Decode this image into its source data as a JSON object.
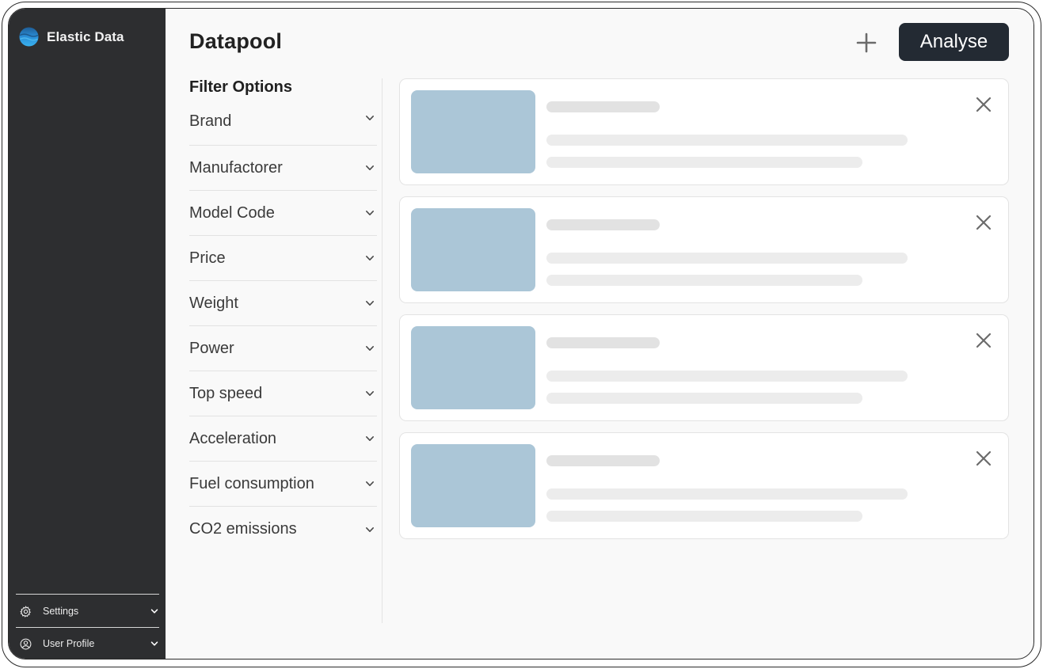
{
  "app": {
    "name": "Elastic Data",
    "logo_icon": "globe-logo-icon"
  },
  "sidebar": {
    "bottom_items": [
      {
        "label": "Settings",
        "icon": "gear-icon"
      },
      {
        "label": "User Profile",
        "icon": "user-circle-icon"
      }
    ]
  },
  "header": {
    "title": "Datapool",
    "add_icon": "plus-icon",
    "analyse_label": "Analyse"
  },
  "filters": {
    "title": "Filter Options",
    "items": [
      {
        "label": "Brand"
      },
      {
        "label": "Manufactorer"
      },
      {
        "label": "Model Code"
      },
      {
        "label": "Price"
      },
      {
        "label": "Weight"
      },
      {
        "label": "Power"
      },
      {
        "label": "Top speed"
      },
      {
        "label": "Acceleration"
      },
      {
        "label": "Fuel consumption"
      },
      {
        "label": "CO2 emissions"
      }
    ]
  },
  "cards": {
    "count": 4,
    "thumb_color": "#abc6d7",
    "close_icon": "close-icon"
  },
  "colors": {
    "sidebar_bg": "#2d2e30",
    "button_bg": "#232a33",
    "main_bg": "#f9f9f9",
    "logo_blue": "#2a8fd8"
  }
}
